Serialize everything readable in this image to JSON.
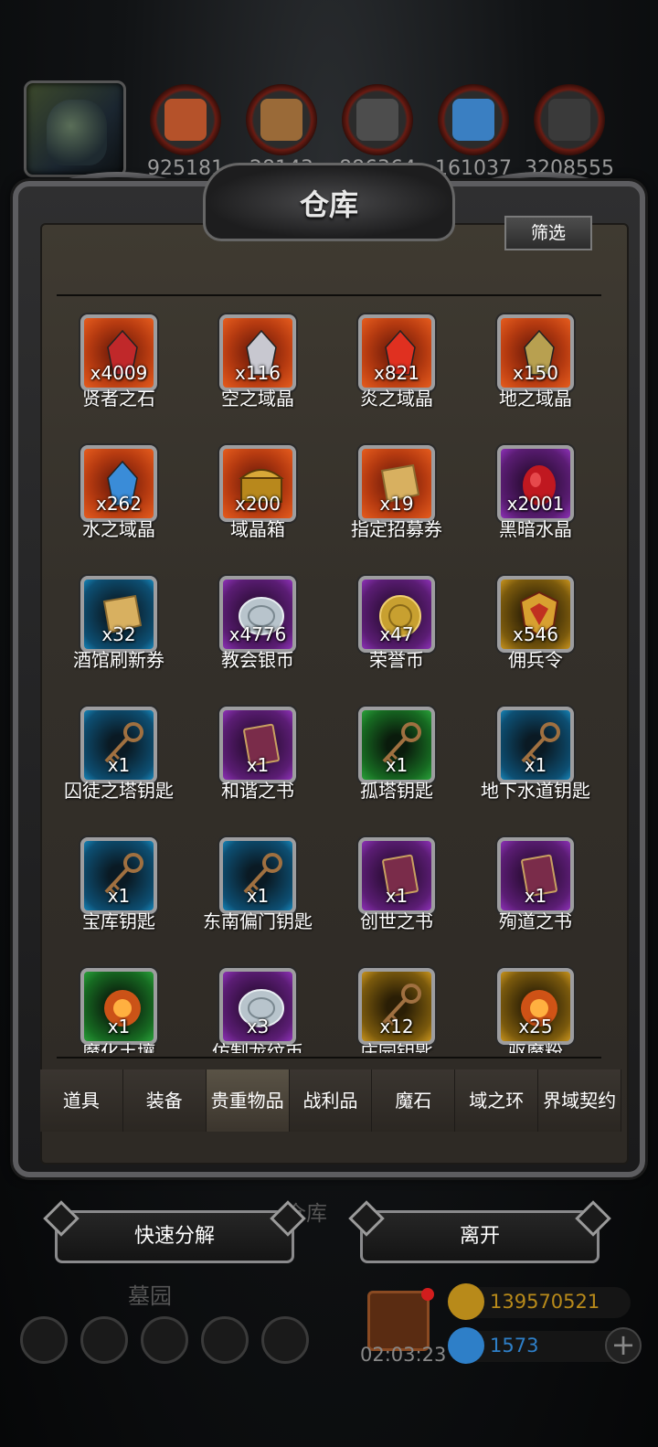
{
  "resources": [
    {
      "icon": "orange-ore-icon",
      "value": "925181",
      "color": "#b5522a"
    },
    {
      "icon": "wood-plank-icon",
      "value": "28143",
      "color": "#9a6a38"
    },
    {
      "icon": "steel-bar-icon",
      "value": "886364",
      "color": "#4d4d4d"
    },
    {
      "icon": "blue-crystal-icon",
      "value": "161037",
      "color": "#3a7fc2"
    },
    {
      "icon": "dark-metal-icon",
      "value": "3208555",
      "color": "#3a3a3a"
    }
  ],
  "panel": {
    "title": "仓库",
    "filter_label": "筛选"
  },
  "items": [
    {
      "name": "贤者之石",
      "count": "x4009",
      "rarity": "red",
      "icon": "sage-stone-icon",
      "accent": "#c0282a"
    },
    {
      "name": "空之域晶",
      "count": "x116",
      "rarity": "red",
      "icon": "sky-crystal-icon",
      "accent": "#c8c8d0"
    },
    {
      "name": "炎之域晶",
      "count": "x821",
      "rarity": "red",
      "icon": "flame-crystal-icon",
      "accent": "#e03020"
    },
    {
      "name": "地之域晶",
      "count": "x150",
      "rarity": "red",
      "icon": "earth-crystal-icon",
      "accent": "#b8a050"
    },
    {
      "name": "水之域晶",
      "count": "x262",
      "rarity": "red",
      "icon": "water-crystal-icon",
      "accent": "#3a8cd8"
    },
    {
      "name": "域晶箱",
      "count": "x200",
      "rarity": "red",
      "icon": "crystal-chest-icon",
      "accent": "#b8881c"
    },
    {
      "name": "指定招募券",
      "count": "x19",
      "rarity": "red",
      "icon": "scroll-icon",
      "accent": "#d8b060"
    },
    {
      "name": "黑暗水晶",
      "count": "x2001",
      "rarity": "purple",
      "icon": "dark-crystal-icon",
      "accent": "#c01820"
    },
    {
      "name": "酒馆刷新券",
      "count": "x32",
      "rarity": "blue",
      "icon": "scroll-icon",
      "accent": "#d8b060"
    },
    {
      "name": "教会银币",
      "count": "x4776",
      "rarity": "purple",
      "icon": "silver-coin-icon",
      "accent": "#b8c4cc"
    },
    {
      "name": "荣誉币",
      "count": "x47",
      "rarity": "purple",
      "icon": "honor-coin-icon",
      "accent": "#c8a030"
    },
    {
      "name": "佣兵令",
      "count": "x546",
      "rarity": "gold",
      "icon": "mercenary-badge-icon",
      "accent": "#c03020"
    },
    {
      "name": "囚徒之塔钥匙",
      "count": "x1",
      "rarity": "blue",
      "icon": "key-icon",
      "accent": "#a07040"
    },
    {
      "name": "和谐之书",
      "count": "x1",
      "rarity": "purple",
      "icon": "book-icon",
      "accent": "#7a2c4a"
    },
    {
      "name": "孤塔钥匙",
      "count": "x1",
      "rarity": "green",
      "icon": "key-icon",
      "accent": "#a07040"
    },
    {
      "name": "地下水道钥匙",
      "count": "x1",
      "rarity": "blue",
      "icon": "key-icon",
      "accent": "#a07040"
    },
    {
      "name": "宝库钥匙",
      "count": "x1",
      "rarity": "blue",
      "icon": "key-icon",
      "accent": "#a07040"
    },
    {
      "name": "东南偏门钥匙",
      "count": "x1",
      "rarity": "blue",
      "icon": "key-icon",
      "accent": "#a07040"
    },
    {
      "name": "创世之书",
      "count": "x1",
      "rarity": "purple",
      "icon": "book-icon",
      "accent": "#7a2c4a"
    },
    {
      "name": "殉道之书",
      "count": "x1",
      "rarity": "purple",
      "icon": "book-icon",
      "accent": "#7a2c4a"
    },
    {
      "name": "魔化土壤",
      "count": "x1",
      "rarity": "green",
      "icon": "fire-orb-icon",
      "accent": "#e05818"
    },
    {
      "name": "仿制龙纹币",
      "count": "x3",
      "rarity": "purple",
      "icon": "silver-coin-icon",
      "accent": "#b8c4cc"
    },
    {
      "name": "庄园钥匙",
      "count": "x12",
      "rarity": "gold",
      "icon": "key-icon",
      "accent": "#a07040"
    },
    {
      "name": "驱魔粉",
      "count": "x25",
      "rarity": "gold",
      "icon": "fire-orb-icon",
      "accent": "#e05818"
    }
  ],
  "tabs": [
    "道具",
    "装备",
    "贵重物品",
    "战利品",
    "魔石",
    "域之环",
    "界域契约"
  ],
  "bottom": {
    "label": "仓库",
    "quick_decompose": "快速分解",
    "leave": "离开"
  },
  "footer": {
    "map_label": "墓园",
    "timer": "02:03:23",
    "gold": "139570521",
    "gem": "1573",
    "gold_color": "#b88a1a",
    "gem_color": "#2e7fc8"
  }
}
